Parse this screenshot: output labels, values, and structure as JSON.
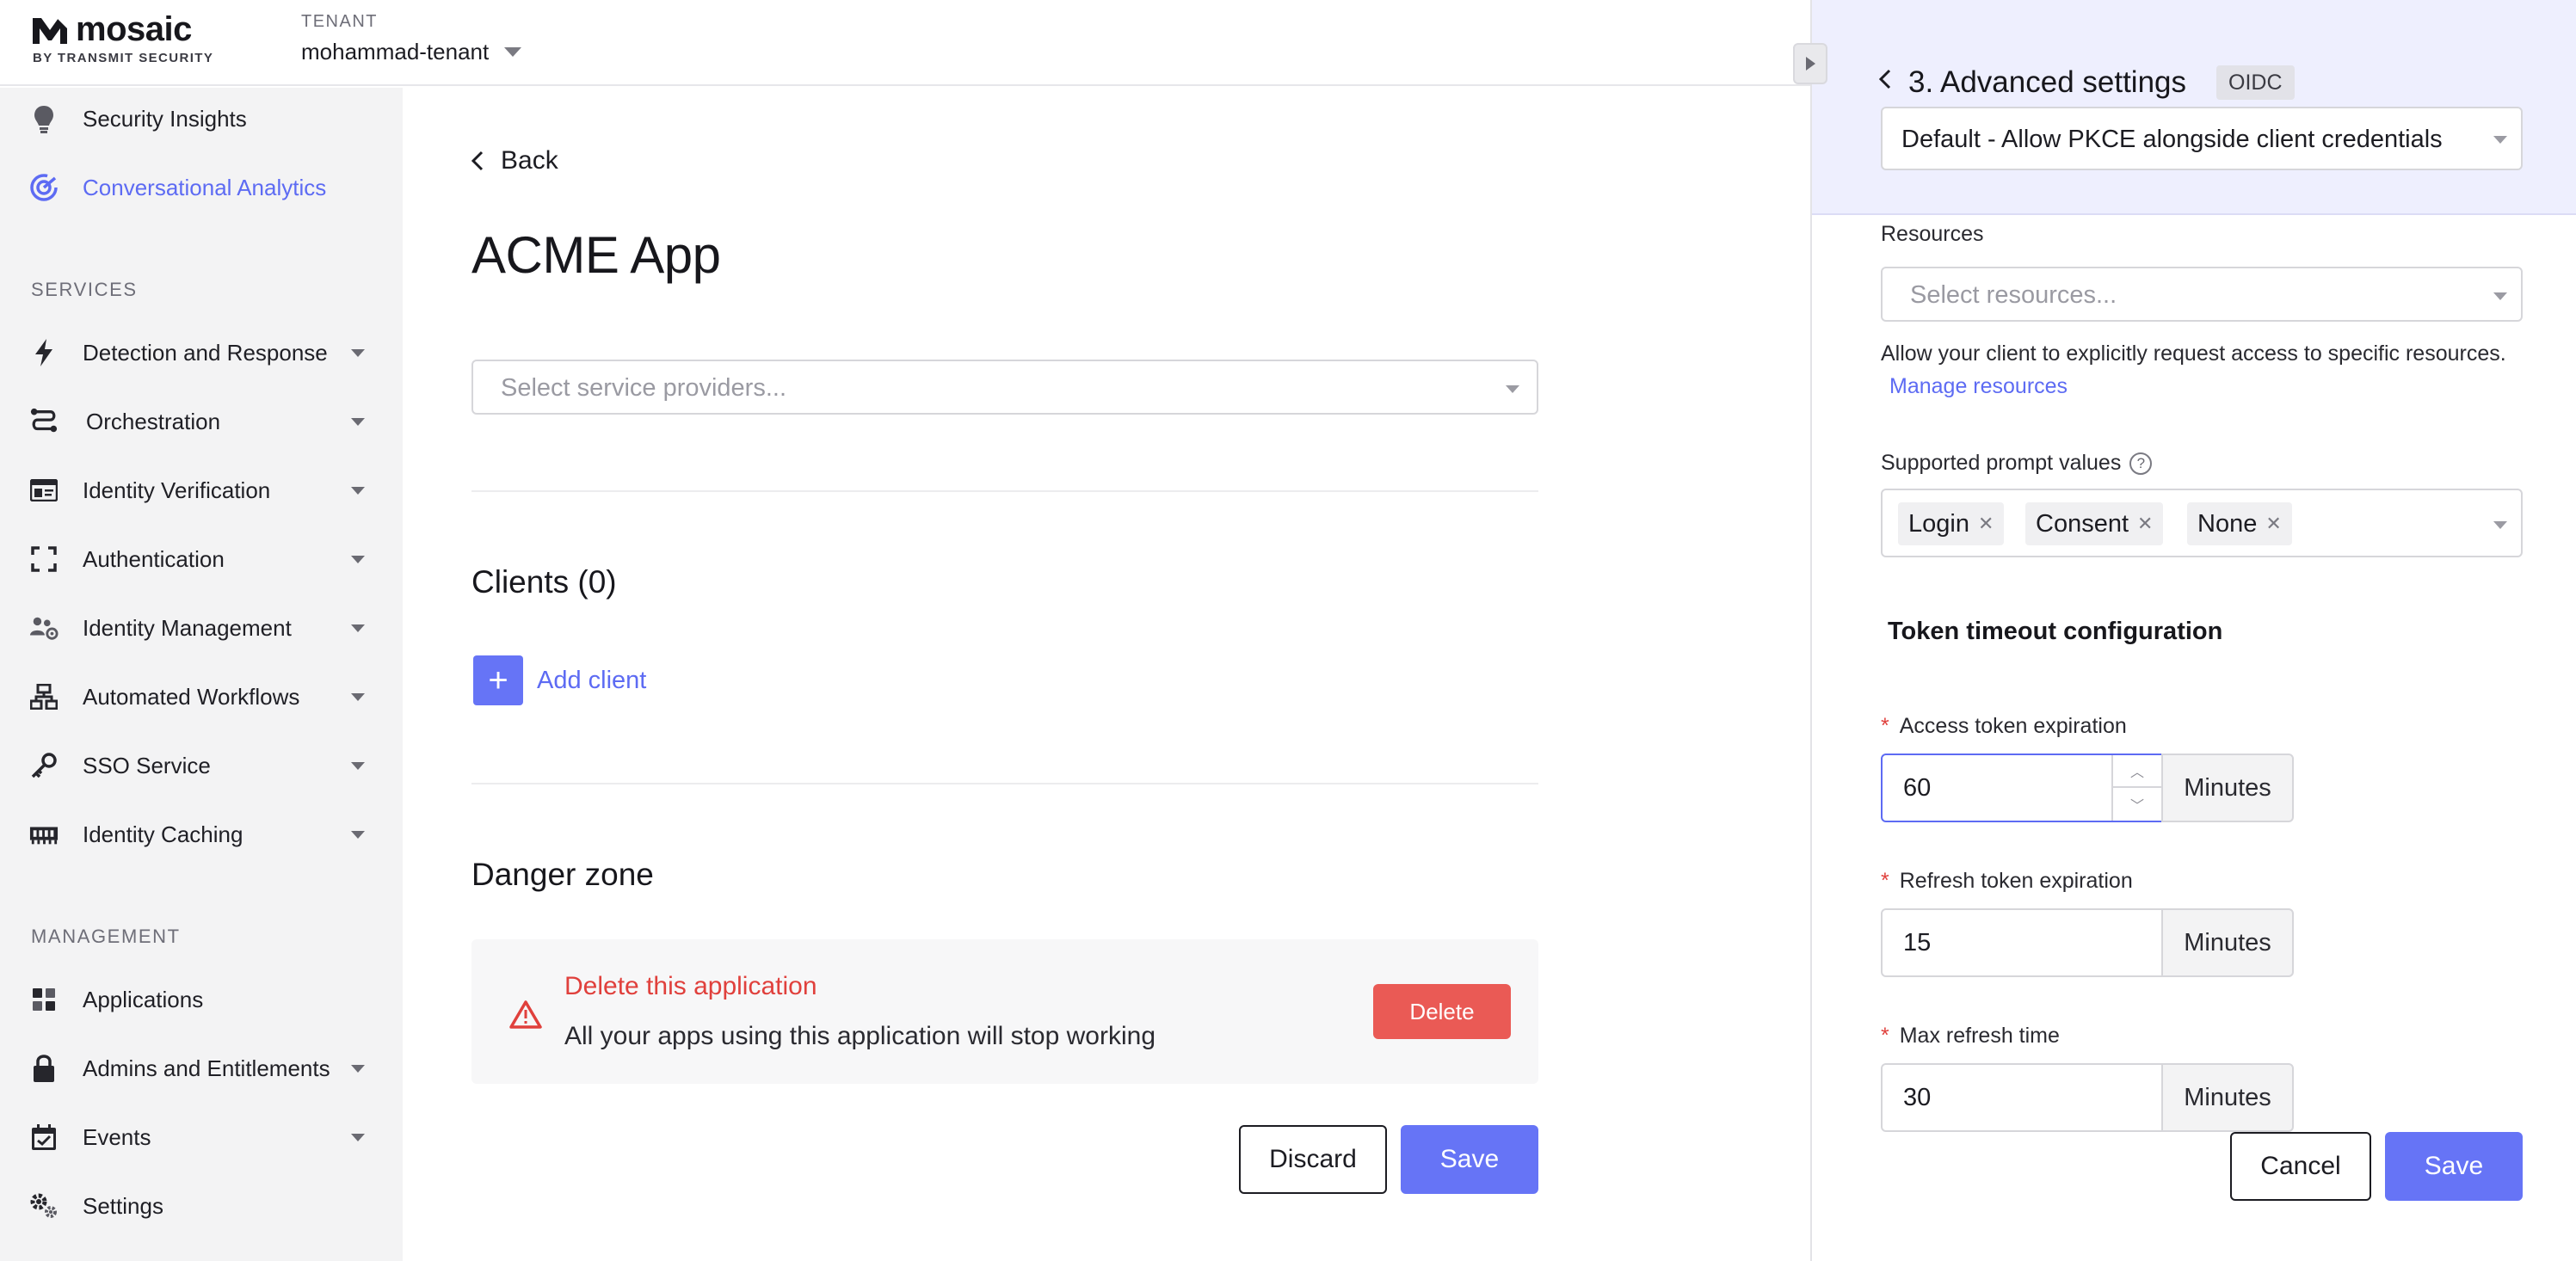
{
  "brand": {
    "name": "mosaic",
    "sub": "BY TRANSMIT SECURITY"
  },
  "tenant": {
    "label": "TENANT",
    "name": "mohammad-tenant"
  },
  "sidebar": {
    "items_top": [
      {
        "label": "Security Insights",
        "icon": "lightbulb-icon"
      },
      {
        "label": "Conversational Analytics",
        "icon": "analytics-icon",
        "active": true
      }
    ],
    "services_label": "SERVICES",
    "services": [
      {
        "label": "Detection and Response",
        "icon": "lightning-icon"
      },
      {
        "label": "Orchestration",
        "icon": "route-icon"
      },
      {
        "label": "Identity Verification",
        "icon": "id-card-icon"
      },
      {
        "label": "Authentication",
        "icon": "scan-frame-icon"
      },
      {
        "label": "Identity Management",
        "icon": "users-gear-icon"
      },
      {
        "label": "Automated Workflows",
        "icon": "workflow-icon"
      },
      {
        "label": "SSO Service",
        "icon": "key-icon"
      },
      {
        "label": "Identity Caching",
        "icon": "memory-icon"
      }
    ],
    "management_label": "MANAGEMENT",
    "management": [
      {
        "label": "Applications",
        "icon": "grid-icon"
      },
      {
        "label": "Admins and Entitlements",
        "icon": "lock-icon"
      },
      {
        "label": "Events",
        "icon": "calendar-icon"
      },
      {
        "label": "Settings",
        "icon": "gears-icon"
      }
    ]
  },
  "main": {
    "back_label": "Back",
    "title": "ACME App",
    "service_providers_placeholder": "Select service providers...",
    "clients_title": "Clients (0)",
    "add_client_label": "Add client",
    "danger_title": "Danger zone",
    "danger_heading": "Delete this application",
    "danger_text": "All your apps using this application will stop working",
    "delete_label": "Delete",
    "discard_label": "Discard",
    "save_label": "Save"
  },
  "panel": {
    "title": "3. Advanced settings",
    "badge": "OIDC",
    "pkce_value": "Default - Allow PKCE alongside client credentials",
    "resources_label": "Resources",
    "resources_placeholder": "Select resources...",
    "resources_help": "Allow your client to explicitly request access to specific resources.",
    "resources_link": "Manage resources",
    "prompt_label": "Supported prompt values",
    "prompt_values": [
      "Login",
      "Consent",
      "None"
    ],
    "token_section_title": "Token timeout configuration",
    "access_label": "Access token expiration",
    "access_value": "60",
    "refresh_label": "Refresh token expiration",
    "refresh_value": "15",
    "max_refresh_label": "Max refresh time",
    "max_refresh_value": "30",
    "unit_label": "Minutes",
    "cancel_label": "Cancel",
    "save_label": "Save"
  },
  "colors": {
    "accent": "#6674f6",
    "danger": "#e0403c",
    "sidebar_bg": "#f3f3f4",
    "panel_header_bg": "#eeeffe"
  }
}
